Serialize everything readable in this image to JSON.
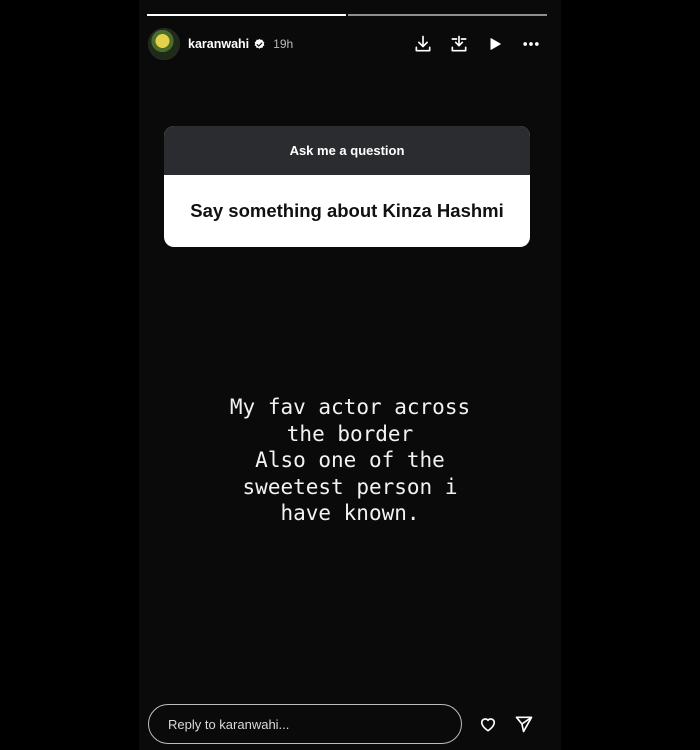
{
  "story": {
    "username": "karanwahi",
    "time": "19h",
    "progress_total": 2,
    "progress_current": 1
  },
  "icons": {
    "download": "download-icon",
    "save_to_archive": "download-stack-icon",
    "play": "play-icon",
    "more": "more-icon",
    "verified": "verified-badge-icon",
    "like": "heart-icon",
    "share": "send-icon"
  },
  "question_sticker": {
    "title": "Ask me a question",
    "question": "Say something about Kinza Hashmi"
  },
  "answer_text": "My fav actor across\nthe border\nAlso one of the\nsweetest person i\nhave known.",
  "reply": {
    "placeholder": "Reply to karanwahi..."
  },
  "colors": {
    "background": "#000000",
    "story_background": "#0a0a0a",
    "sticker_header": "#2b2c2f",
    "sticker_body": "#ffffff",
    "verified": "#ffffff"
  }
}
